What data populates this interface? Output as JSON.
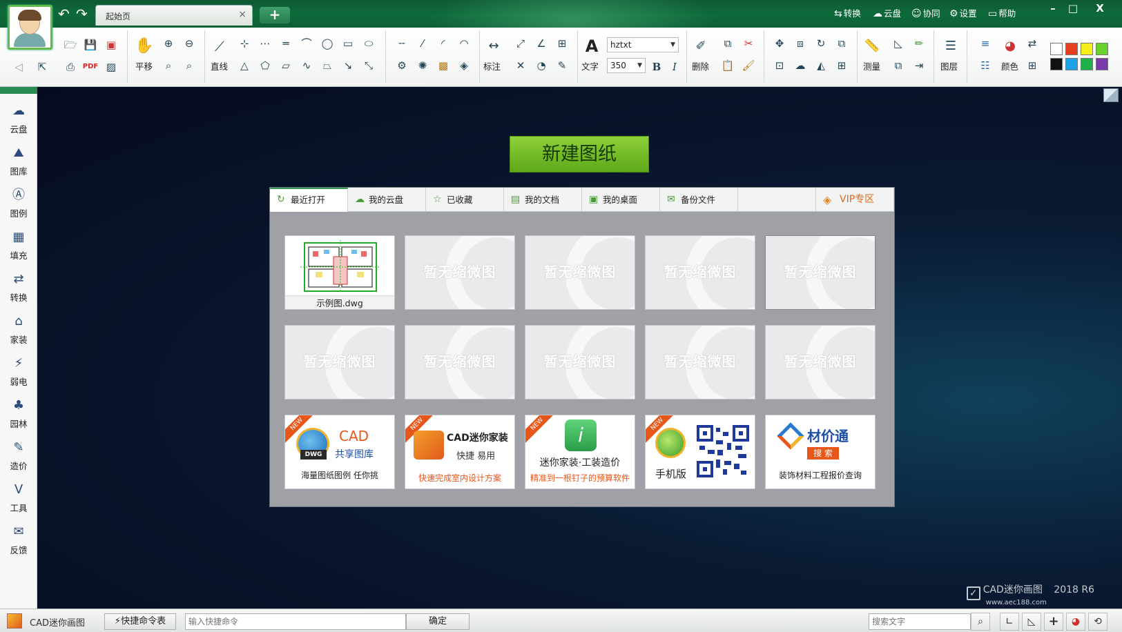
{
  "window": {
    "tab_title": "起始页",
    "tab_close": "×",
    "new_tab": "+",
    "back": "↶",
    "forward": "↷",
    "links": [
      {
        "name": "convert",
        "icon": "⇆",
        "label": "转换"
      },
      {
        "name": "cloud",
        "icon": "☁",
        "label": "云盘"
      },
      {
        "name": "collab",
        "icon": "☺",
        "label": "协同"
      },
      {
        "name": "settings",
        "icon": "⚙",
        "label": "设置"
      },
      {
        "name": "help",
        "icon": "▭",
        "label": "帮助"
      }
    ],
    "minimize": "–",
    "maximize": "□",
    "close": "X"
  },
  "ribbon": {
    "pan": "平移",
    "line": "直线",
    "dimension": "标注",
    "text": "文字",
    "font_name": "hztxt",
    "font_size": "350",
    "bold": "B",
    "italic": "I",
    "erase": "删除",
    "measure": "测量",
    "layer": "图层",
    "color": "颜色",
    "palette": [
      "#ffffff",
      "#e8401e",
      "#f5ee1a",
      "#69d12a",
      "#111111",
      "#1fa3e8",
      "#1fb04a",
      "#7a3aa8"
    ]
  },
  "sidebar": [
    {
      "name": "cloud",
      "icon": "☁",
      "label": "云盘"
    },
    {
      "name": "gallery",
      "icon": "⛰",
      "label": "图库"
    },
    {
      "name": "legend",
      "icon": "Ⓐ",
      "label": "图例"
    },
    {
      "name": "hatch",
      "icon": "▦",
      "label": "填充"
    },
    {
      "name": "convert",
      "icon": "⇄",
      "label": "转换"
    },
    {
      "name": "home-deco",
      "icon": "⌂",
      "label": "家装"
    },
    {
      "name": "weak-current",
      "icon": "⚡",
      "label": "弱电"
    },
    {
      "name": "garden",
      "icon": "♣",
      "label": "园林"
    },
    {
      "name": "cost",
      "icon": "✎",
      "label": "造价"
    },
    {
      "name": "tools",
      "icon": "V",
      "label": "工具"
    },
    {
      "name": "feedback",
      "icon": "✉",
      "label": "反馈"
    }
  ],
  "main": {
    "new_drawing": "新建图纸",
    "tabs": [
      {
        "name": "recent",
        "icon": "↻",
        "label": "最近打开"
      },
      {
        "name": "my-cloud",
        "icon": "☁",
        "label": "我的云盘"
      },
      {
        "name": "favorites",
        "icon": "☆",
        "label": "已收藏"
      },
      {
        "name": "my-docs",
        "icon": "▤",
        "label": "我的文档"
      },
      {
        "name": "desktop",
        "icon": "▣",
        "label": "我的桌面"
      },
      {
        "name": "backup",
        "icon": "✉",
        "label": "备份文件"
      }
    ],
    "vip_tab": {
      "icon": "◈",
      "label": "VIP专区"
    },
    "recent_file": "示例图.dwg",
    "placeholder": "暂无缩微图",
    "ads": [
      {
        "title": "CAD",
        "subtitle": "共享图库",
        "badge": "DWG",
        "caption": "海量图纸图例 任你挑",
        "tag": "NEW"
      },
      {
        "title": "CAD迷你家装",
        "subtitle": "快捷 易用",
        "caption": "快速完成室内设计方案",
        "tag": "NEW"
      },
      {
        "title": "迷你家装·工装造价",
        "caption": "精准到一根钉子的预算软件",
        "tag": "NEW"
      },
      {
        "title": "手机版",
        "tag": "NEW"
      },
      {
        "title": "材价通",
        "subtitle": "搜 索",
        "caption": "装饰材料工程报价查询"
      }
    ]
  },
  "watermark": {
    "brand": "CAD迷你画图",
    "version": "2018 R6",
    "url": "www.aec188.com"
  },
  "status": {
    "app_name": "CAD迷你画图",
    "cmd_table": "快捷命令表",
    "cmd_placeholder": "输入快捷命令",
    "confirm": "确定",
    "search_placeholder": "搜索文字"
  }
}
